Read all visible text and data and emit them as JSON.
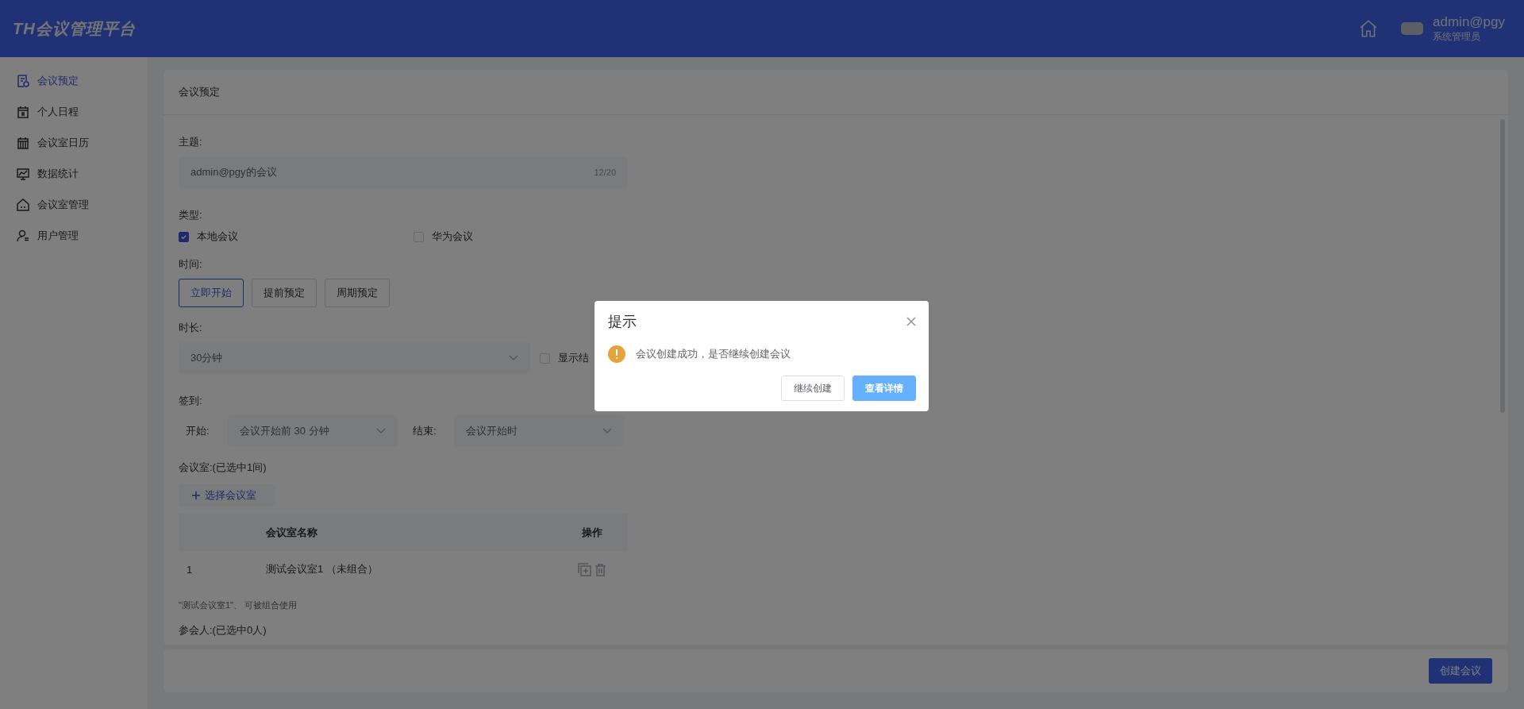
{
  "header": {
    "logo": "TH会议管理平台",
    "user": {
      "name": "admin@pgy",
      "role": "系统管理员"
    }
  },
  "sidebar": {
    "items": [
      {
        "label": "会议预定",
        "selected": true
      },
      {
        "label": "个人日程",
        "selected": false
      },
      {
        "label": "会议室日历",
        "selected": false
      },
      {
        "label": "数据统计",
        "selected": false
      },
      {
        "label": "会议室管理",
        "selected": false
      },
      {
        "label": "用户管理",
        "selected": false
      }
    ]
  },
  "page": {
    "title": "会议预定"
  },
  "form": {
    "subject": {
      "label": "主题:",
      "value": "admin@pgy的会议",
      "counter": "12/20"
    },
    "type": {
      "label": "类型:",
      "options": [
        {
          "label": "本地会议",
          "checked": true
        },
        {
          "label": "华为会议",
          "checked": false
        }
      ]
    },
    "time": {
      "label": "时间:",
      "buttons": [
        {
          "label": "立即开始",
          "selected": true
        },
        {
          "label": "提前预定",
          "selected": false
        },
        {
          "label": "周期预定",
          "selected": false
        }
      ]
    },
    "duration": {
      "label": "时长:",
      "value": "30分钟",
      "show_end": {
        "label": "显示结",
        "checked": false
      }
    },
    "checkin": {
      "label": "签到:",
      "start_label": "开始:",
      "start_value": "会议开始前 30 分钟",
      "end_label": "结束:",
      "end_value": "会议开始时"
    },
    "rooms": {
      "label": "会议室:(已选中1间)",
      "add_button": "选择会议室",
      "columns": [
        {
          "label": "会议室名称"
        },
        {
          "label": "操作"
        }
      ],
      "rows": [
        {
          "index": "1",
          "name": "测试会议室1 （未组合）"
        }
      ],
      "note": "\"测试会议室1\"、 可被组合使用"
    },
    "participants": {
      "label": "参会人:(已选中0人)"
    }
  },
  "footer": {
    "submit": "创建会议"
  },
  "dialog": {
    "title": "提示",
    "message": "会议创建成功，是否继续创建会议",
    "buttons": [
      {
        "label": "继续创建",
        "kind": "default"
      },
      {
        "label": "查看详情",
        "kind": "primary"
      }
    ]
  }
}
